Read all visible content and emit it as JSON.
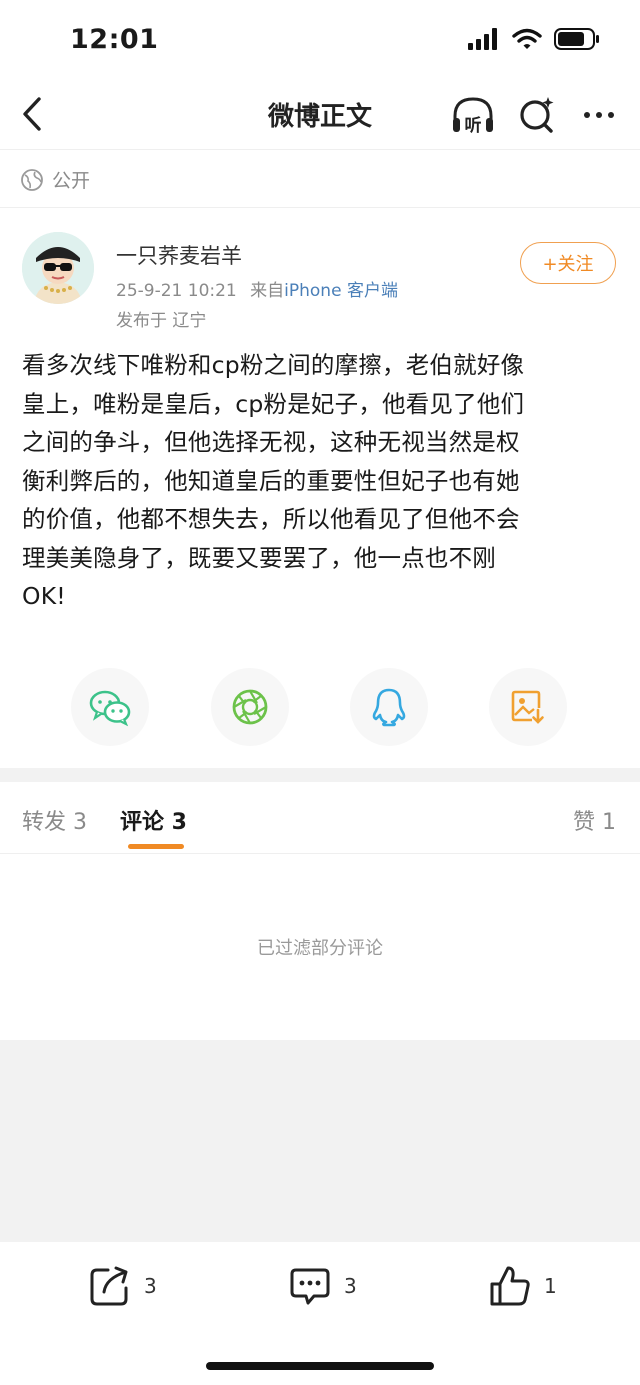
{
  "status_bar": {
    "time": "12:01"
  },
  "nav": {
    "title": "微博正文",
    "listen_label": "听"
  },
  "visibility": {
    "label": "公开"
  },
  "author": {
    "name": "一只荞麦岩羊",
    "timestamp": "25-9-21 10:21",
    "source_prefix": "来自",
    "source": "iPhone 客户端",
    "location": "发布于 辽宁",
    "follow_label": "+关注"
  },
  "post": {
    "text": "看多次线下唯粉和cp粉之间的摩擦，老伯就好像\n皇上，唯粉是皇后，cp粉是妃子，他看见了他们\n之间的争斗，但他选择无视，这种无视当然是权\n衡利弊后的，他知道皇后的重要性但妃子也有她\n的价值，他都不想失去，所以他看见了但他不会\n理美美隐身了，既要又要罢了，他一点也不刚\nOK!"
  },
  "share": {
    "wechat_color": "#3cc28a",
    "moments_color": "#6cc24a",
    "qq_color": "#35a8e0",
    "save_color": "#f0a030"
  },
  "tabs": {
    "repost": "转发 3",
    "comment": "评论 3",
    "like": "赞 1",
    "accent": "#f08a24"
  },
  "comments": {
    "filtered_note": "已过滤部分评论"
  },
  "bottom_bar": {
    "repost_count": "3",
    "comment_count": "3",
    "like_count": "1"
  }
}
